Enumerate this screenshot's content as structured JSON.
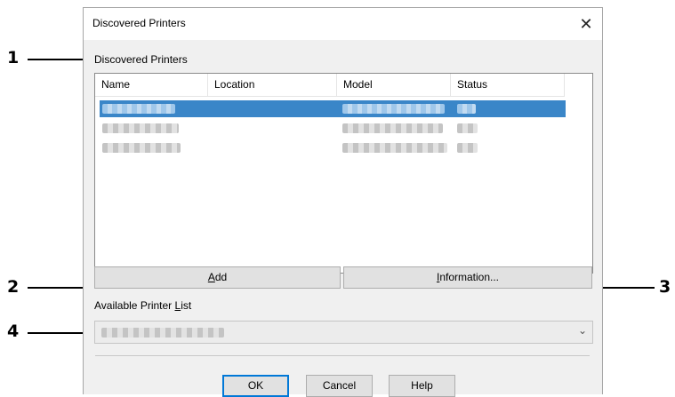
{
  "dialog": {
    "title": "Discovered Printers",
    "close_icon": "close-icon"
  },
  "group": {
    "label": "Discovered Printers"
  },
  "list": {
    "columns": [
      "Name",
      "Location",
      "Model",
      "Status"
    ],
    "selected_color": "#3a86c8"
  },
  "buttons": {
    "add_mnemonic": "A",
    "add_rest": "dd",
    "info_mnemonic": "I",
    "info_rest": "nformation...",
    "ok": "OK",
    "cancel": "Cancel",
    "help": "Help"
  },
  "available": {
    "label_prefix": "Available Printer ",
    "label_mnemonic": "L",
    "label_rest": "ist"
  },
  "callouts": [
    "1",
    "2",
    "3",
    "4"
  ]
}
